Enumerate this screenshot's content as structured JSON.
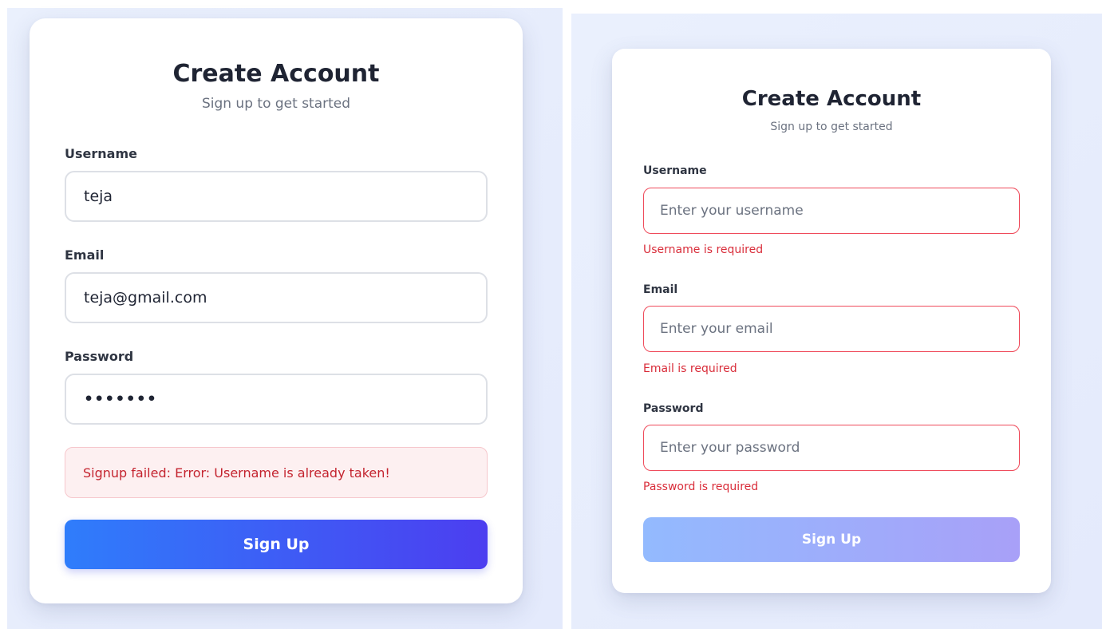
{
  "left_form": {
    "title": "Create Account",
    "subtitle": "Sign up to get started",
    "username_label": "Username",
    "username_value": "teja",
    "email_label": "Email",
    "email_value": "teja@gmail.com",
    "password_label": "Password",
    "password_value": "•••••••",
    "error_alert": "Signup failed: Error: Username is already taken!",
    "submit_label": "Sign Up"
  },
  "right_form": {
    "title": "Create Account",
    "subtitle": "Sign up to get started",
    "username_label": "Username",
    "username_placeholder": "Enter your username",
    "username_error": "Username is required",
    "email_label": "Email",
    "email_placeholder": "Enter your email",
    "email_error": "Email is required",
    "password_label": "Password",
    "password_placeholder": "Enter your password",
    "password_error": "Password is required",
    "submit_label": "Sign Up"
  },
  "colors": {
    "background": "#e6ecfc",
    "primary_gradient_start": "#2f7dfb",
    "primary_gradient_end": "#4c3ef0",
    "disabled_gradient_start": "#93bafe",
    "disabled_gradient_end": "#a8a0f8",
    "error": "#d92d3a",
    "error_border": "#ef4b5b",
    "alert_background": "#fdf0f1"
  }
}
